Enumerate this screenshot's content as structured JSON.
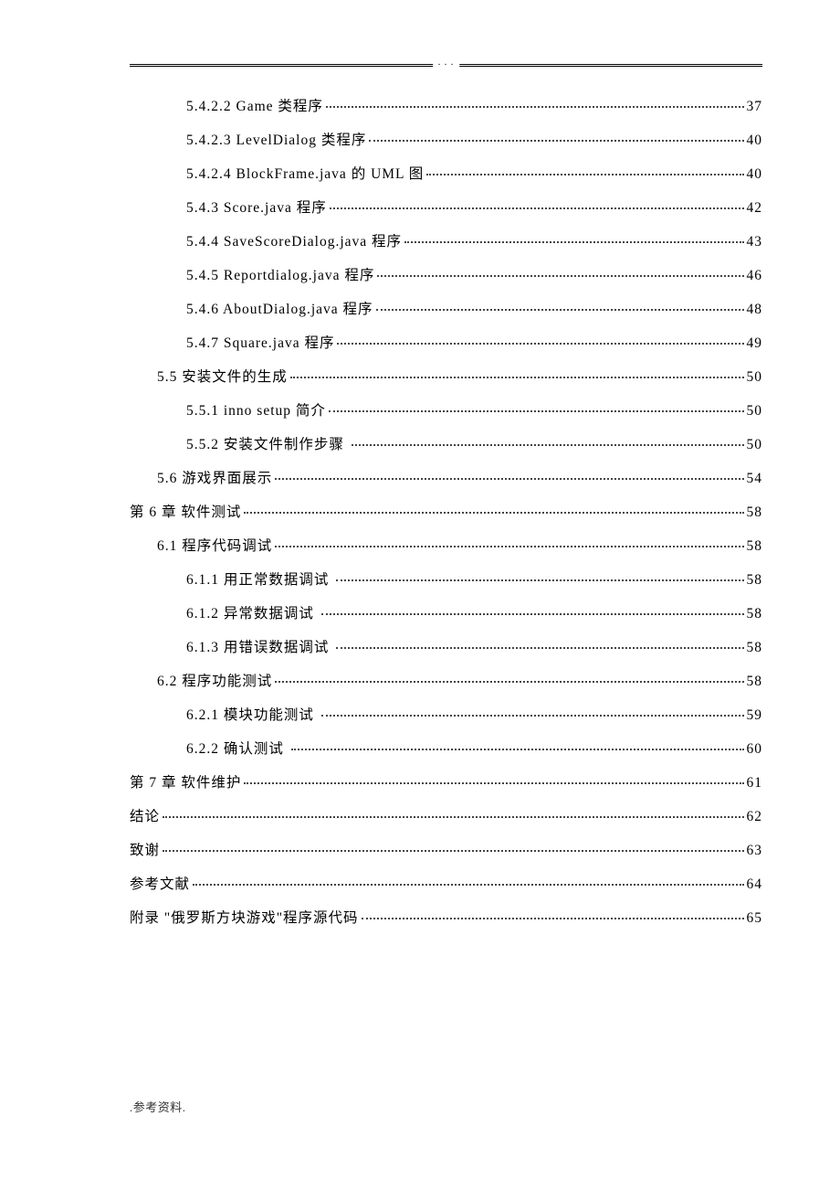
{
  "header_marker": ". . .",
  "footer": ".参考资料.",
  "toc": [
    {
      "indent": 4,
      "label": "5.4.2.2 Game 类程序",
      "page": "37"
    },
    {
      "indent": 4,
      "label": "5.4.2.3 LevelDialog 类程序",
      "page": "40"
    },
    {
      "indent": 4,
      "label": "5.4.2.4 BlockFrame.java 的 UML 图",
      "page": "40"
    },
    {
      "indent": 3,
      "label": "5.4.3 Score.java 程序",
      "page": "42"
    },
    {
      "indent": 3,
      "label": "5.4.4 SaveScoreDialog.java 程序",
      "page": "43"
    },
    {
      "indent": 3,
      "label": "5.4.5 Reportdialog.java 程序",
      "page": "46"
    },
    {
      "indent": 3,
      "label": "5.4.6 AboutDialog.java 程序",
      "page": "48"
    },
    {
      "indent": 3,
      "label": "5.4.7 Square.java 程序",
      "page": "49"
    },
    {
      "indent": 2,
      "label": "5.5 安装文件的生成",
      "page": "50"
    },
    {
      "indent": 3,
      "label": "5.5.1 inno setup 简介",
      "page": "50"
    },
    {
      "indent": 3,
      "label": "5.5.2 安装文件制作步骤 ",
      "page": "50"
    },
    {
      "indent": 2,
      "label": "5.6 游戏界面展示",
      "page": "54"
    },
    {
      "indent": 1,
      "label": "第 6 章 软件测试",
      "page": "58"
    },
    {
      "indent": 2,
      "label": "6.1 程序代码调试",
      "page": "58"
    },
    {
      "indent": 3,
      "label": "6.1.1 用正常数据调试 ",
      "page": "58"
    },
    {
      "indent": 3,
      "label": "6.1.2 异常数据调试 ",
      "page": "58"
    },
    {
      "indent": 3,
      "label": "6.1.3 用错误数据调试 ",
      "page": "58"
    },
    {
      "indent": 2,
      "label": "6.2 程序功能测试",
      "page": "58"
    },
    {
      "indent": 3,
      "label": "6.2.1 模块功能测试 ",
      "page": "59"
    },
    {
      "indent": 3,
      "label": "6.2.2 确认测试 ",
      "page": "60"
    },
    {
      "indent": 1,
      "label": "第 7 章 软件维护",
      "page": "61"
    },
    {
      "indent": 1,
      "label": "结论",
      "page": "62"
    },
    {
      "indent": 1,
      "label": "致谢",
      "page": "63"
    },
    {
      "indent": 1,
      "label": "参考文献",
      "page": "64"
    },
    {
      "indent": 1,
      "label": "附录 \"俄罗斯方块游戏\"程序源代码",
      "page": "65"
    }
  ]
}
